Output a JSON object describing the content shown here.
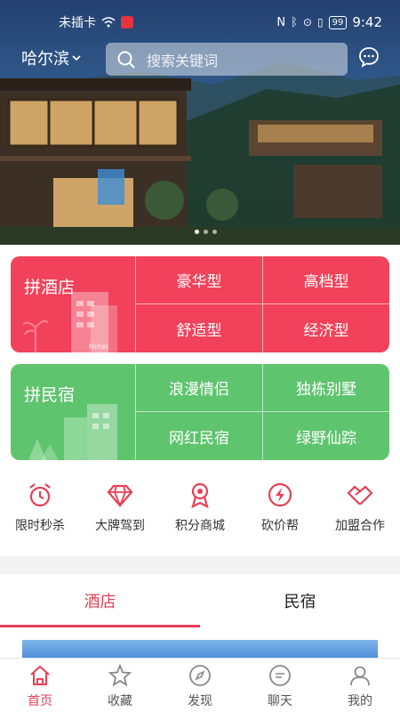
{
  "status": {
    "carrier": "未插卡",
    "battery": "99",
    "time": "9:42"
  },
  "header": {
    "city": "哈尔滨",
    "search_placeholder": "搜索关键词"
  },
  "hotel_card": {
    "title": "拼酒店",
    "art_text": "Hotel",
    "options": [
      "豪华型",
      "高档型",
      "舒适型",
      "经济型"
    ]
  },
  "minsu_card": {
    "title": "拼民宿",
    "options": [
      "浪漫情侣",
      "独栋别墅",
      "网红民宿",
      "绿野仙踪"
    ]
  },
  "quick_links": [
    {
      "label": "限时秒杀",
      "icon": "alarm-clock-icon"
    },
    {
      "label": "大牌驾到",
      "icon": "diamond-icon"
    },
    {
      "label": "积分商城",
      "icon": "medal-icon"
    },
    {
      "label": "砍价帮",
      "icon": "lightning-icon"
    },
    {
      "label": "加盟合作",
      "icon": "handshake-icon"
    }
  ],
  "tabs": [
    "酒店",
    "民宿"
  ],
  "nav": [
    {
      "label": "首页",
      "icon": "home-icon"
    },
    {
      "label": "收藏",
      "icon": "star-icon"
    },
    {
      "label": "发现",
      "icon": "compass-icon"
    },
    {
      "label": "聊天",
      "icon": "chat-icon"
    },
    {
      "label": "我的",
      "icon": "user-icon"
    }
  ],
  "colors": {
    "accent": "#e84054",
    "hotel_card": "#f2415a",
    "minsu_card": "#5fc46e"
  }
}
